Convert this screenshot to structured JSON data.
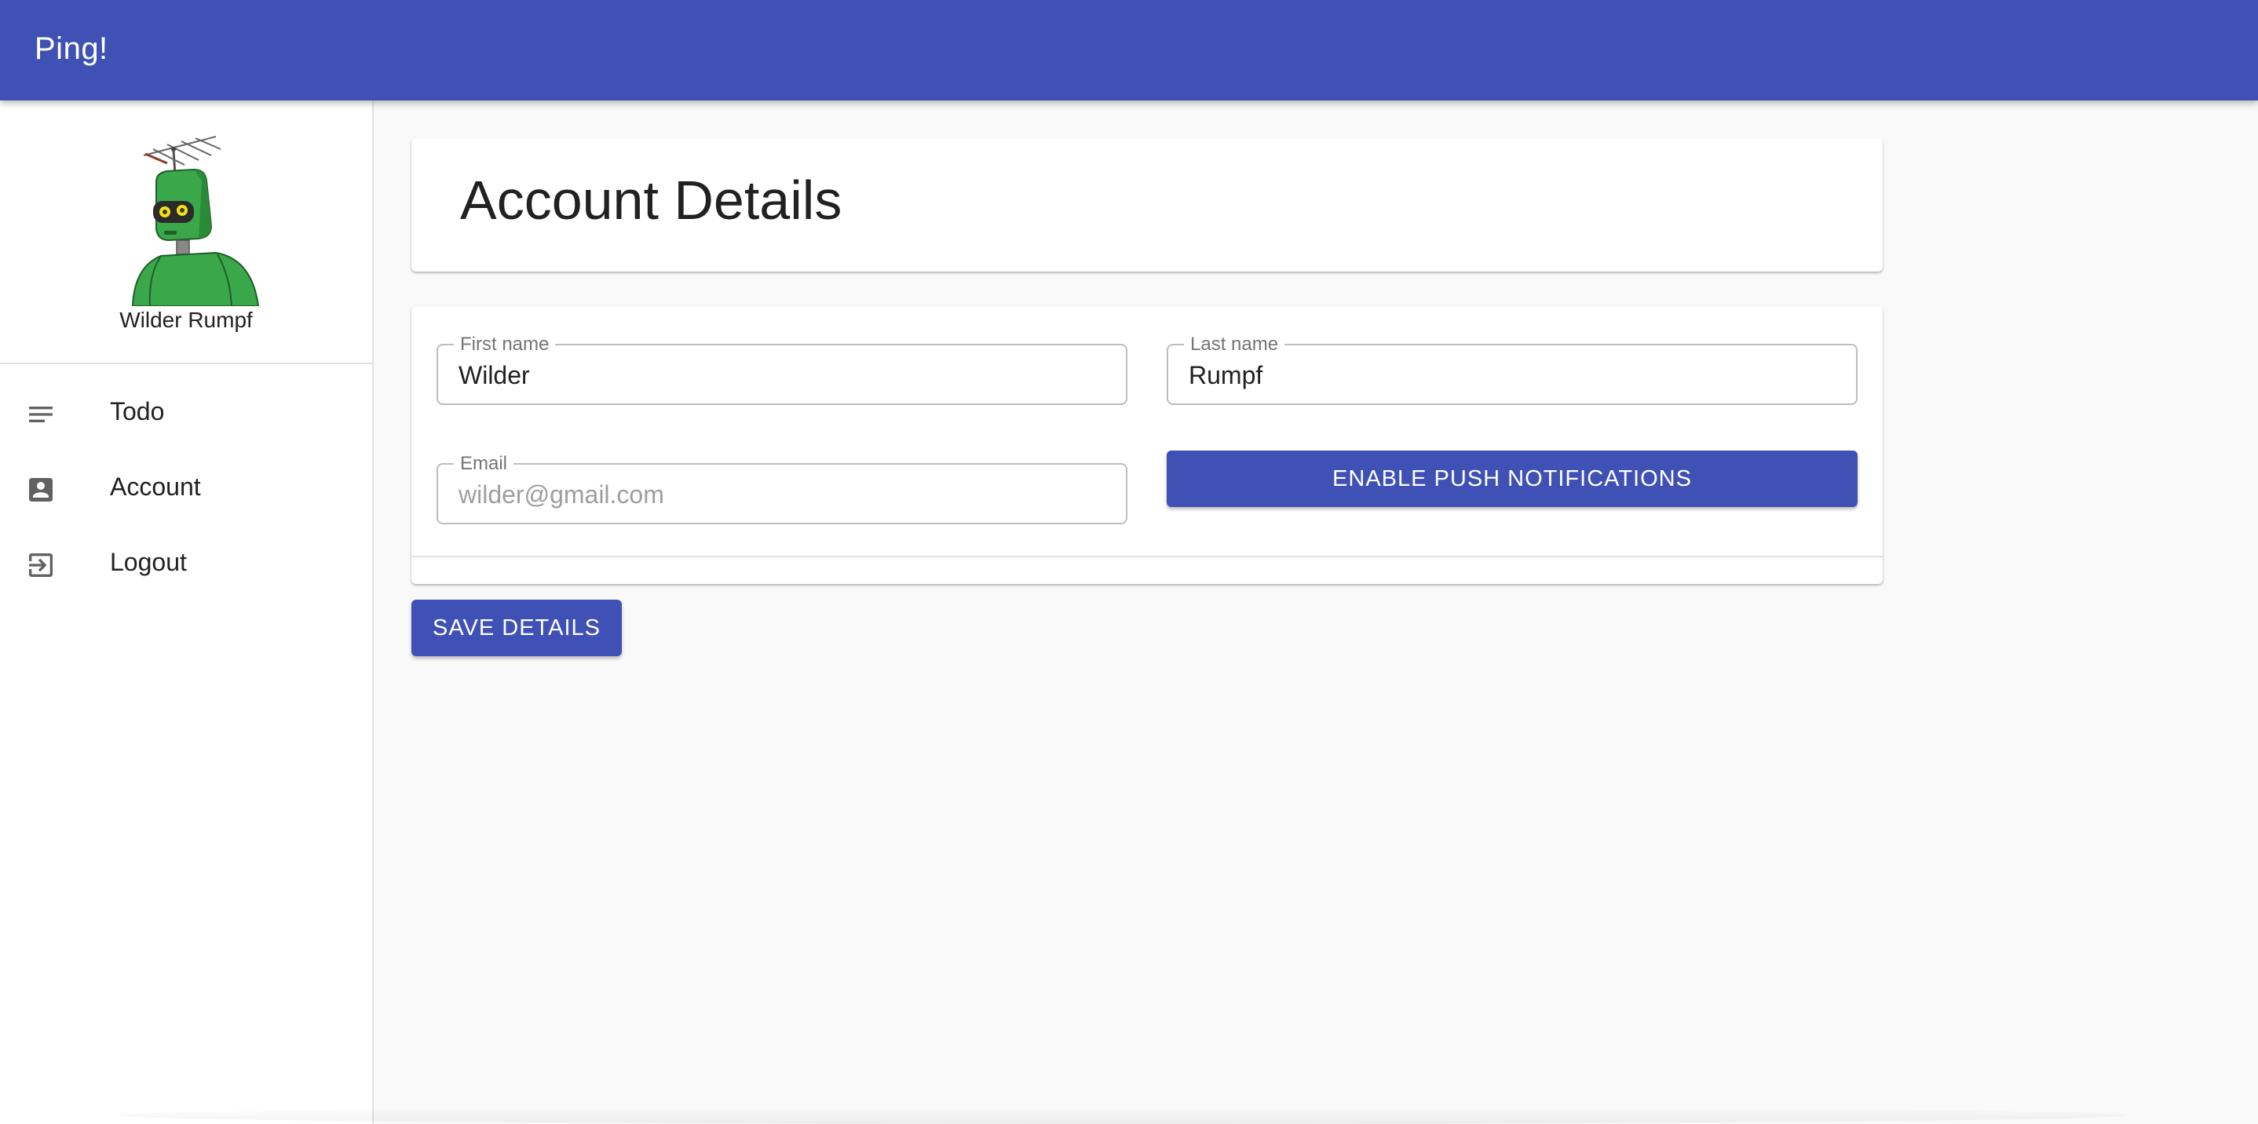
{
  "app": {
    "title": "Ping!"
  },
  "profile": {
    "name": "Wilder Rumpf"
  },
  "nav": {
    "items": [
      {
        "label": "Todo",
        "icon": "list-icon"
      },
      {
        "label": "Account",
        "icon": "account-box-icon"
      },
      {
        "label": "Logout",
        "icon": "logout-icon"
      }
    ]
  },
  "main": {
    "title": "Account Details",
    "form": {
      "first_name": {
        "label": "First name",
        "value": "Wilder"
      },
      "last_name": {
        "label": "Last name",
        "value": "Rumpf"
      },
      "email": {
        "label": "Email",
        "placeholder": "wilder@gmail.com",
        "value": ""
      },
      "push_button_label": "Enable Push Notifications"
    },
    "save_button_label": "Save Details"
  },
  "colors": {
    "primary": "#3f51b5",
    "background": "#f9f9f9",
    "surface": "#ffffff",
    "avatar_green": "#3aa84a"
  }
}
